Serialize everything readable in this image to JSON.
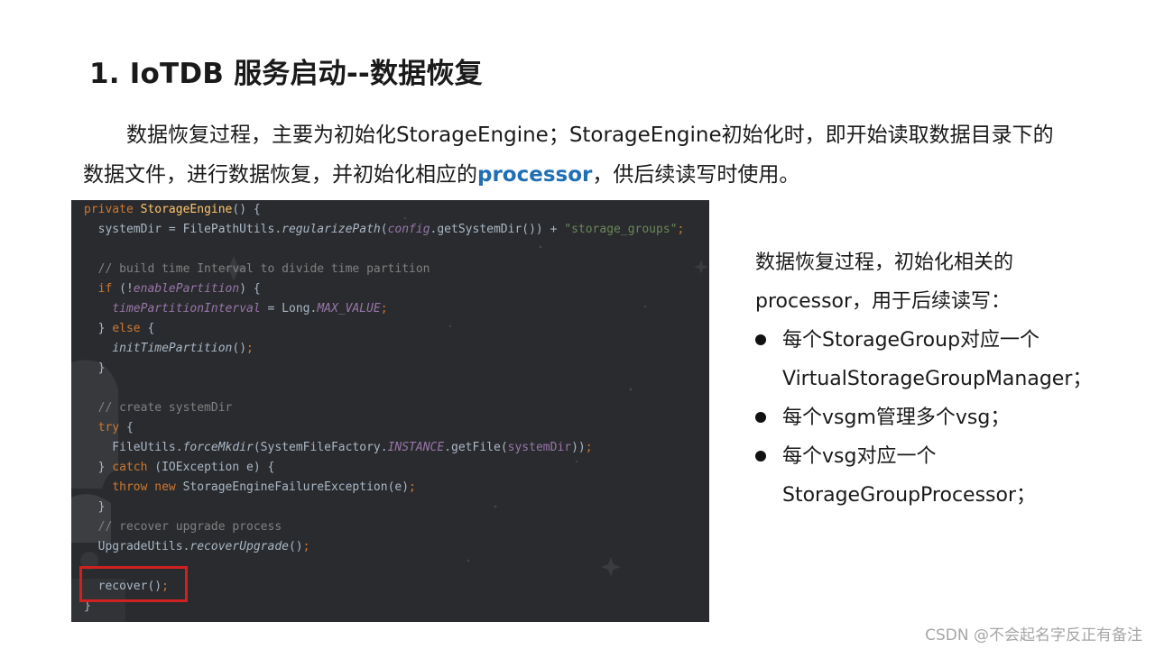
{
  "title": "1. IoTDB 服务启动--数据恢复",
  "intro": {
    "line1": "数据恢复过程，主要为初始化StorageEngine；StorageEngine初始化时，即开始读取数据目录下的",
    "line2_before": "数据文件，进行数据恢复，并初始化相应的",
    "line2_highlight": "processor",
    "line2_after": "，供后续读写时使用。"
  },
  "side": {
    "line1": "数据恢复过程，初始化相关的",
    "line2": "processor，用于后续读写：",
    "bullets": [
      {
        "line1": "每个StorageGroup对应一个",
        "line2": "VirtualStorageGroupManager；"
      },
      {
        "line1": "每个vsgm管理多个vsg；",
        "line2": ""
      },
      {
        "line1": "每个vsg对应一个",
        "line2": "StorageGroupProcessor；"
      }
    ]
  },
  "code": {
    "lines": [
      "private StorageEngine() {",
      "  systemDir = FilePathUtils.regularizePath(config.getSystemDir()) + \"storage_groups\";",
      "",
      "  // build time Interval to divide time partition",
      "  if (!enablePartition) {",
      "    timePartitionInterval = Long.MAX_VALUE;",
      "  } else {",
      "    initTimePartition();",
      "  }",
      "",
      "  // create systemDir",
      "  try {",
      "    FileUtils.forceMkdir(SystemFileFactory.INSTANCE.getFile(systemDir));",
      "  } catch (IOException e) {",
      "    throw new StorageEngineFailureException(e);",
      "  }",
      "  // recover upgrade process",
      "  UpgradeUtils.recoverUpgrade();",
      "",
      "  recover();",
      "}"
    ]
  },
  "watermark": "CSDN @不会起名字反正有备注"
}
